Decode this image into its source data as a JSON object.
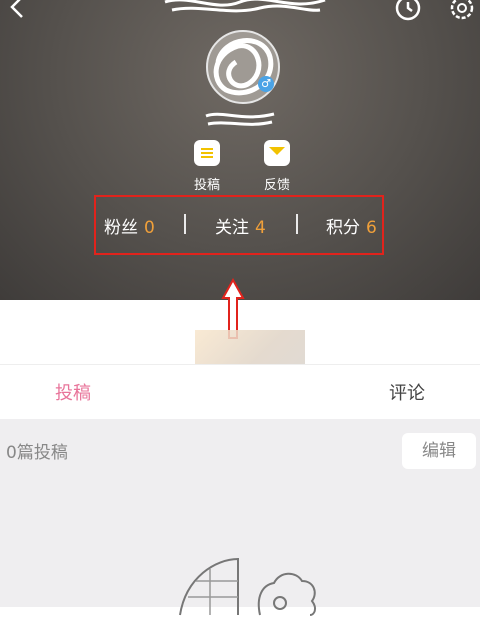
{
  "header": {
    "actions": [
      {
        "label": "投稿",
        "icon": "list-icon"
      },
      {
        "label": "反馈",
        "icon": "envelope-icon"
      }
    ],
    "stats": [
      {
        "label": "粉丝",
        "value": "0"
      },
      {
        "label": "关注",
        "value": "4"
      },
      {
        "label": "积分",
        "value": "6"
      }
    ]
  },
  "tabs": {
    "left": "投稿",
    "right": "评论"
  },
  "content": {
    "post_count": "0篇投稿",
    "edit_label": "编辑"
  },
  "colors": {
    "accent_pink": "#e8749a",
    "stat_value_orange": "#f0a03a",
    "highlight_red": "#e1231c"
  }
}
